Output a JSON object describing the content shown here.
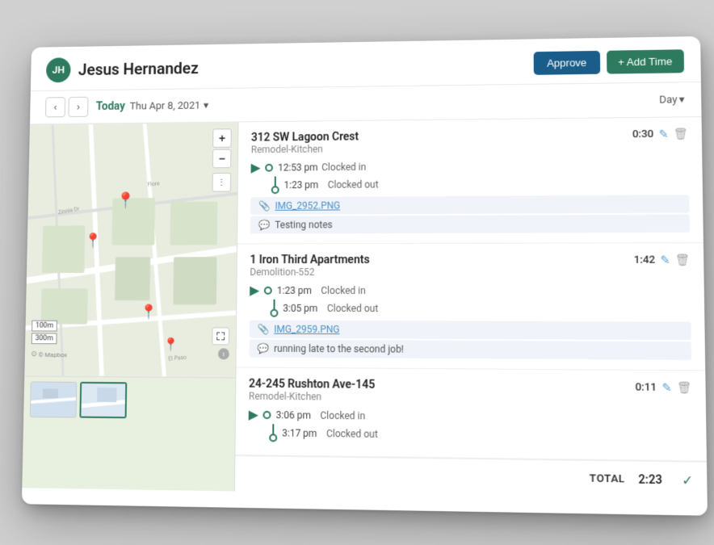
{
  "header": {
    "avatar_initials": "JH",
    "user_name": "Jesus Hernandez",
    "approve_label": "Approve",
    "add_time_label": "+ Add Time"
  },
  "nav": {
    "today_label": "Today",
    "date_label": "Thu Apr 8, 2021",
    "date_caret": "▾",
    "day_label": "Day",
    "day_caret": "▾"
  },
  "map": {
    "zoom_in": "+",
    "zoom_out": "−",
    "scale_100m": "100m",
    "scale_300m": "300m",
    "mapbox_label": "© Mapbox"
  },
  "jobs": [
    {
      "id": "job-1",
      "title": "312 SW Lagoon Crest",
      "subtitle": "Remodel-Kitchen",
      "duration": "0:30",
      "clock_in_time": "12:53 pm",
      "clock_in_label": "Clocked in",
      "clock_out_time": "1:23 pm",
      "clock_out_label": "Clocked out",
      "attachment": "IMG_2952.PNG",
      "note": "Testing notes"
    },
    {
      "id": "job-2",
      "title": "1 Iron Third Apartments",
      "subtitle": "Demolition-552",
      "duration": "1:42",
      "clock_in_time": "1:23 pm",
      "clock_in_label": "Clocked in",
      "clock_out_time": "3:05 pm",
      "clock_out_label": "Clocked out",
      "attachment": "IMG_2959.PNG",
      "note": "running late to the second job!"
    },
    {
      "id": "job-3",
      "title": "24-245 Rushton Ave-145",
      "subtitle": "Remodel-Kitchen",
      "duration": "0:11",
      "clock_in_time": "3:06 pm",
      "clock_in_label": "Clocked in",
      "clock_out_time": "3:17 pm",
      "clock_out_label": "Clocked out",
      "attachment": null,
      "note": null
    }
  ],
  "total": {
    "label": "TOTAL",
    "value": "2:23"
  }
}
